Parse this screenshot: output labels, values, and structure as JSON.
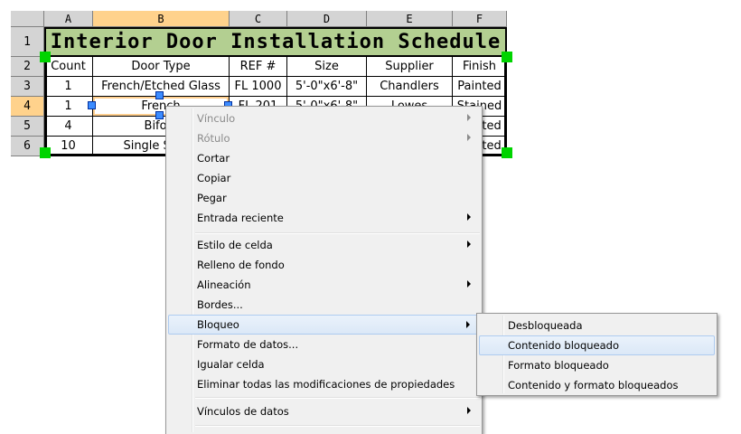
{
  "sheet": {
    "columns": [
      "A",
      "B",
      "C",
      "D",
      "E",
      "F"
    ],
    "rows": [
      "1",
      "2",
      "3",
      "4",
      "5",
      "6"
    ],
    "title": "Interior Door Installation Schedule",
    "headers": [
      "Count",
      "Door Type",
      "REF #",
      "Size",
      "Supplier",
      "Finish"
    ],
    "data": [
      [
        "1",
        "French/Etched Glass",
        "FL 1000",
        "5'-0\"x6'-8\"",
        "Chandlers",
        "Painted"
      ],
      [
        "1",
        "French",
        "FL 201",
        "5'-0\"x6'-8\"",
        "Lowes",
        "Stained"
      ],
      [
        "4",
        "Bifold",
        "",
        "",
        "",
        "Painted"
      ],
      [
        "10",
        "Single Swing",
        "",
        "",
        "",
        "Painted"
      ]
    ]
  },
  "context_menu": {
    "items": [
      {
        "label": "Vínculo",
        "disabled": true,
        "submenu": true
      },
      {
        "label": "Rótulo",
        "disabled": true,
        "submenu": true
      },
      {
        "label": "Cortar"
      },
      {
        "label": "Copiar"
      },
      {
        "label": "Pegar"
      },
      {
        "label": "Entrada reciente",
        "submenu": true
      },
      {
        "separator": true
      },
      {
        "label": "Estilo de celda",
        "submenu": true
      },
      {
        "label": "Relleno de fondo"
      },
      {
        "label": "Alineación",
        "submenu": true
      },
      {
        "label": "Bordes..."
      },
      {
        "label": "Bloqueo",
        "submenu": true,
        "highlighted": true
      },
      {
        "label": "Formato de datos..."
      },
      {
        "label": "Igualar celda"
      },
      {
        "label": "Eliminar todas las modificaciones de propiedades"
      },
      {
        "separator": true
      },
      {
        "label": "Vínculos de datos",
        "submenu": true
      }
    ]
  },
  "submenu": {
    "items": [
      {
        "label": "Desbloqueada"
      },
      {
        "label": "Contenido bloqueado",
        "highlighted": true
      },
      {
        "label": "Formato bloqueado"
      },
      {
        "label": "Contenido y formato bloqueados"
      }
    ]
  }
}
